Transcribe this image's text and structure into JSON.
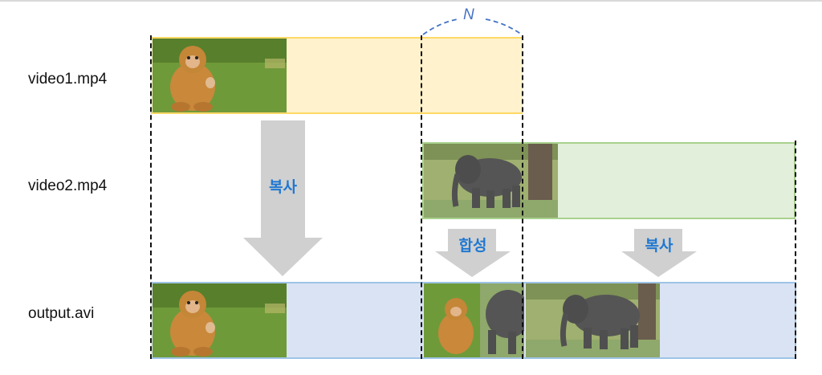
{
  "labels": {
    "video1": "video1.mp4",
    "video2": "video2.mp4",
    "output": "output.avi"
  },
  "annotations": {
    "copy_left": "복사",
    "composite": "합성",
    "copy_right": "복사",
    "n_marker": "N"
  },
  "colors": {
    "video1_band": "#fff2cc",
    "video2_band": "#e2efda",
    "output_band": "#dae3f3",
    "arrow": "#d0d0d0",
    "arrow_text": "#1f78d1",
    "n_marker": "#4472c4"
  },
  "images": {
    "video1_frame": "monkey",
    "video2_frame": "elephant",
    "output_frame_1": "monkey",
    "output_frame_2": "monkey-elephant-blend",
    "output_frame_3": "elephant"
  }
}
